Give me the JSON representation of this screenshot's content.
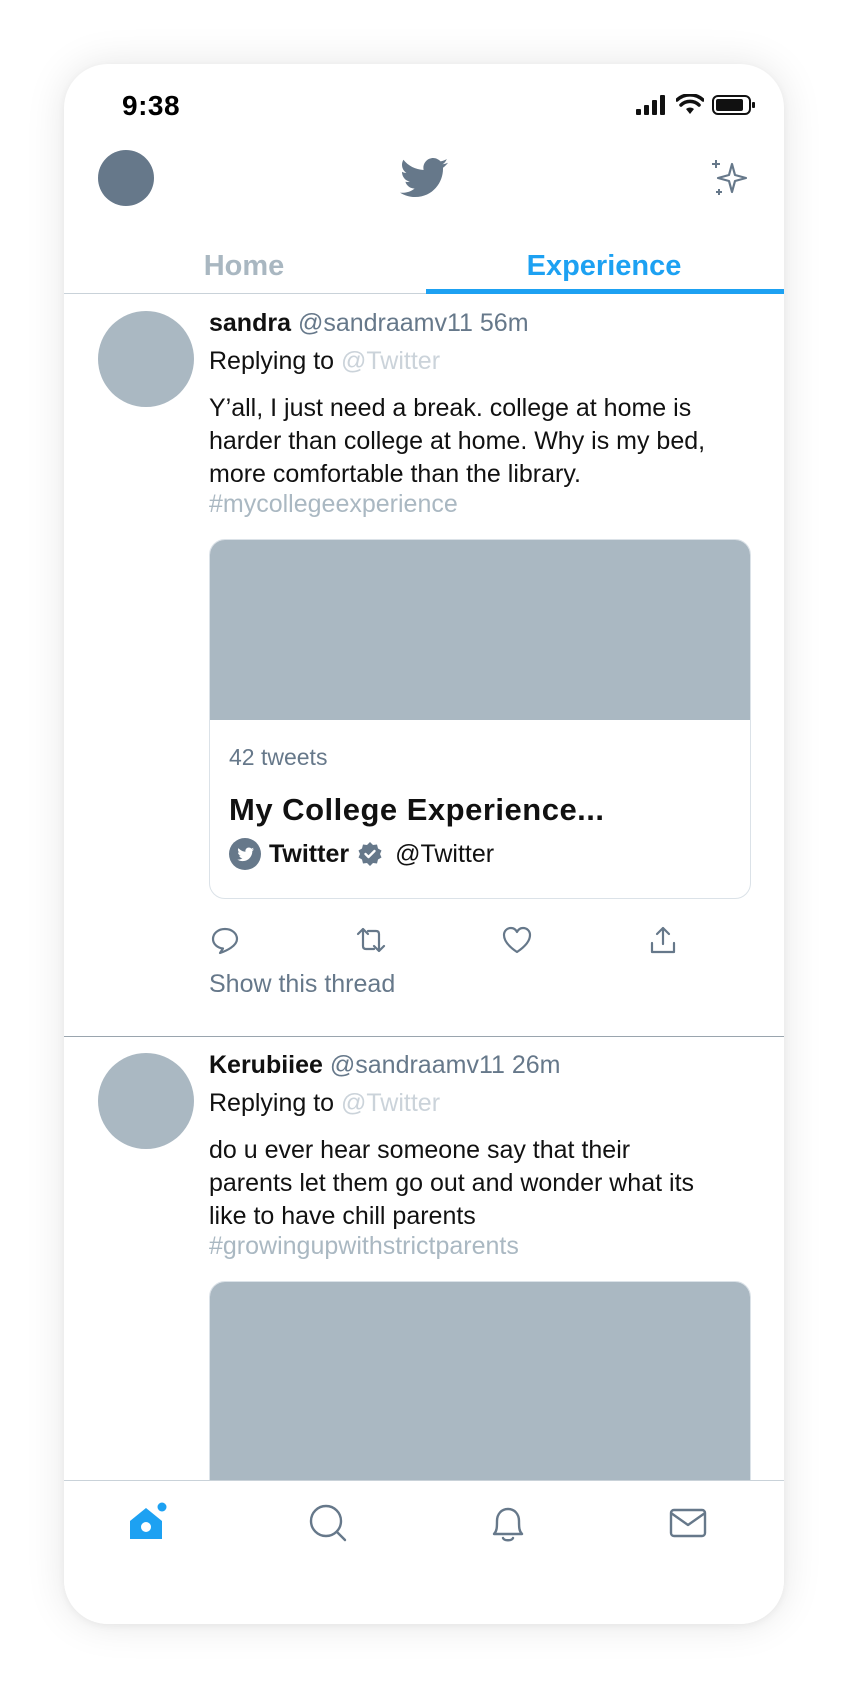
{
  "status": {
    "time": "9:38"
  },
  "tabs": {
    "home": "Home",
    "experience": "Experience"
  },
  "tweets": [
    {
      "name": "sandra",
      "handle": "@sandraamv11",
      "time": "56m",
      "replying_label": "Replying to",
      "replying_to": "@Twitter",
      "body": "Y’all, I just need a break. college at home is harder than college at home. Why is my bed, more comfortable than the library.",
      "hashtag": "#mycollegeexperience",
      "card": {
        "count": "42 tweets",
        "title": "My College Experience...",
        "by_name": "Twitter",
        "by_handle": "@Twitter"
      },
      "show_thread": "Show this thread"
    },
    {
      "name": "Kerubiiee",
      "handle": "@sandraamv11",
      "time": "26m",
      "replying_label": "Replying to",
      "replying_to": "@Twitter",
      "body": "do u ever hear someone say that their parents let them go out and wonder what its like to have chill parents",
      "hashtag": "#growingupwithstrictparents"
    }
  ],
  "colors": {
    "accent": "#1da1f2",
    "secondary_text": "#66788a",
    "placeholder_gray": "#aab8c2"
  },
  "icons": {
    "top_bar": [
      "twitter-bird-icon",
      "sparkle-icon"
    ],
    "actions": [
      "reply-icon",
      "retweet-icon",
      "like-icon",
      "share-icon"
    ],
    "bottom_nav": [
      "home-icon",
      "search-icon",
      "notifications-icon",
      "messages-icon"
    ]
  }
}
